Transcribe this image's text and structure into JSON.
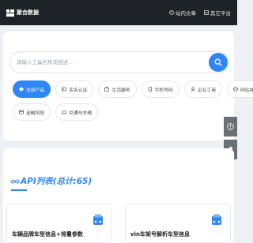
{
  "header": {
    "brand": "聚合数据",
    "nav": [
      {
        "label": "站内文章",
        "icon": "article-icon"
      },
      {
        "label": "其它平台",
        "icon": "platform-icon"
      }
    ]
  },
  "search": {
    "placeholder": "请输入工具名称或描述...",
    "value": ""
  },
  "categories": [
    [
      {
        "label": "全部产品",
        "icon": "grid-icon",
        "active": true
      },
      {
        "label": "实名认证",
        "icon": "id-card-icon",
        "active": false
      },
      {
        "label": "生活服务",
        "icon": "service-icon",
        "active": false
      },
      {
        "label": "手机号码",
        "icon": "phone-icon",
        "active": false
      },
      {
        "label": "企业工商",
        "icon": "company-icon",
        "active": false
      },
      {
        "label": "网站域名",
        "icon": "globe-icon",
        "active": false
      }
    ],
    [
      {
        "label": "金融风险",
        "icon": "finance-icon",
        "active": false
      },
      {
        "label": "交通与车辆",
        "icon": "car-icon",
        "active": false
      }
    ]
  ],
  "api_list": {
    "title": "API列表(总计:65)",
    "items": [
      {
        "name": "车辆品牌车型信息+排量参数"
      },
      {
        "name": "vin车架号解析车型信息"
      }
    ]
  },
  "colors": {
    "accent": "#2f87f5",
    "header_bg": "#1f2226"
  }
}
